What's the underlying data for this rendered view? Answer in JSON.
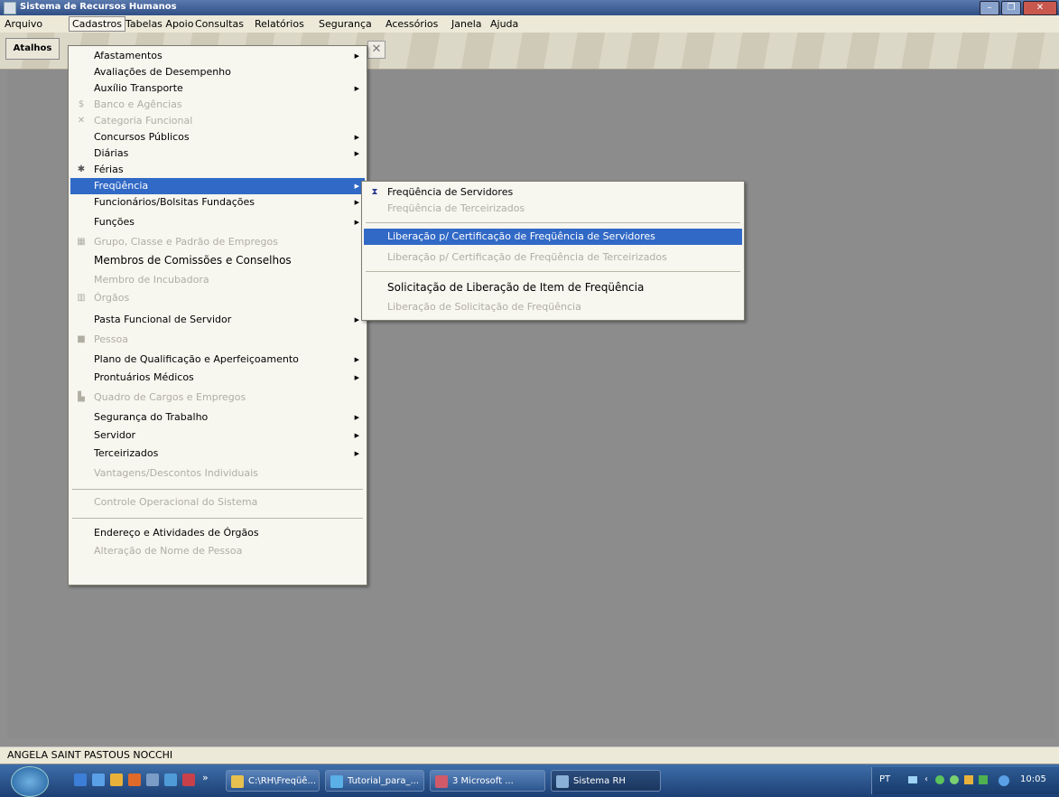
{
  "window": {
    "title": "Sistema de Recursos Humanos"
  },
  "menubar": {
    "items": [
      {
        "label": "Arquivo"
      },
      {
        "label": "Cadastros"
      },
      {
        "label": "Tabelas Apoio"
      },
      {
        "label": "Consultas"
      },
      {
        "label": "Relatórios"
      },
      {
        "label": "Segurança"
      },
      {
        "label": "Acessórios"
      },
      {
        "label": "Janela"
      },
      {
        "label": "Ajuda"
      }
    ]
  },
  "toolbar": {
    "atalhos_label": "Atalhos"
  },
  "cadastros_menu": {
    "items": [
      {
        "label": "Afastamentos",
        "submenu": true
      },
      {
        "label": "Avaliações de Desempenho"
      },
      {
        "label": "Auxílio Transporte",
        "submenu": true
      },
      {
        "label": "Banco e Agências",
        "disabled": true,
        "icon": "dollar-icon"
      },
      {
        "label": "Categoria Funcional",
        "disabled": true,
        "icon": "tools-icon"
      },
      {
        "label": "Concursos Públicos",
        "submenu": true
      },
      {
        "label": "Diárias",
        "submenu": true
      },
      {
        "label": "Férias",
        "icon": "palm-icon"
      },
      {
        "label": "Freqüência",
        "submenu": true,
        "selected": true
      },
      {
        "label": "Funcionários/Bolsitas Fundações",
        "submenu": true
      },
      {
        "label": "Funções",
        "submenu": true
      },
      {
        "label": "Grupo, Classe e Padrão de Empregos",
        "disabled": true,
        "icon": "grid-icon"
      },
      {
        "label": "Membros de Comissões e Conselhos"
      },
      {
        "label": "Membro de Incubadora",
        "disabled": true
      },
      {
        "label": "Órgãos",
        "disabled": true,
        "icon": "building-icon"
      },
      {
        "label": "Pasta Funcional de Servidor",
        "submenu": true
      },
      {
        "label": "Pessoa",
        "disabled": true,
        "icon": "person-icon"
      },
      {
        "label": "Plano de Qualificação e Aperfeiçoamento",
        "submenu": true
      },
      {
        "label": "Prontuários Médicos",
        "submenu": true
      },
      {
        "label": "Quadro de Cargos e Empregos",
        "disabled": true,
        "icon": "chart-icon"
      },
      {
        "label": "Segurança do Trabalho",
        "submenu": true
      },
      {
        "label": "Servidor",
        "submenu": true
      },
      {
        "label": "Terceirizados",
        "submenu": true
      },
      {
        "label": "Vantagens/Descontos Individuais",
        "disabled": true
      },
      {
        "label": "Controle Operacional do Sistema",
        "disabled": true
      },
      {
        "label": "Endereço e Atividades de Órgãos"
      },
      {
        "label": "Alteração de Nome de Pessoa",
        "disabled": true
      }
    ]
  },
  "frequencia_submenu": {
    "items": [
      {
        "label": "Freqüência de Servidores",
        "icon": "hourglass-icon"
      },
      {
        "label": "Freqüência de Terceirizados",
        "disabled": true
      },
      {
        "label": "Liberação p/ Certificação de Freqüência de Servidores",
        "selected": true
      },
      {
        "label": "Liberação p/ Certificação de Freqüência de Terceirizados",
        "disabled": true
      },
      {
        "label": "Solicitação de Liberação de Item de Freqüência"
      },
      {
        "label": "Liberação de Solicitação de Freqüência",
        "disabled": true
      }
    ]
  },
  "status": {
    "user": "ANGELA SAINT PASTOUS NOCCHI"
  },
  "taskbar": {
    "tasks": [
      {
        "label": "C:\\RH\\Freqüê..."
      },
      {
        "label": "Tutorial_para_..."
      },
      {
        "label": "3 Microsoft ..."
      },
      {
        "label": "Sistema RH"
      }
    ],
    "tray_lang": "PT",
    "clock": "10:05"
  }
}
